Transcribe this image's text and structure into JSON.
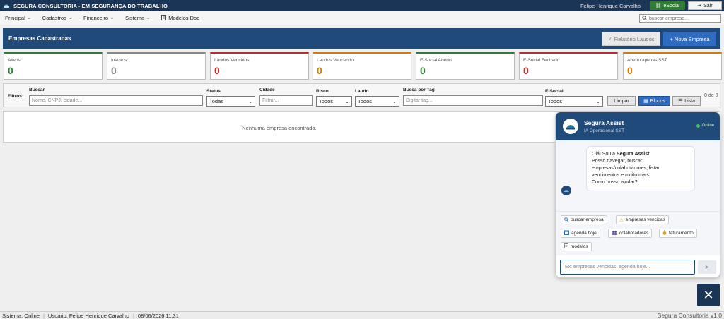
{
  "titlebar": {
    "title": "SEGURA CONSULTORIA - EM SEGURANÇA DO TRABALHO",
    "user": "Felipe Henrique Carvalho",
    "esocial_label": "eSocial",
    "sair_label": "Sair"
  },
  "menu": {
    "items": [
      {
        "label": "Principal",
        "has_dropdown": true
      },
      {
        "label": "Cadastros",
        "has_dropdown": true
      },
      {
        "label": "Financeiro",
        "has_dropdown": true
      },
      {
        "label": "Sistema",
        "has_dropdown": true
      },
      {
        "label": "Modelos Doc",
        "has_dropdown": false
      }
    ],
    "search_placeholder": "buscar empresa..."
  },
  "panel": {
    "title": "Empresas Cadastradas",
    "relatorio_label": "Relatório Laudos",
    "nova_label": "+ Nova Empresa"
  },
  "cards": [
    {
      "label": "Ativos",
      "value": "0",
      "color": "#2e7d32"
    },
    {
      "label": "Inativos",
      "value": "0",
      "color": "#888888"
    },
    {
      "label": "Laudos Vencidos",
      "value": "0",
      "color": "#c62828"
    },
    {
      "label": "Laudos Vencendo",
      "value": "0",
      "color": "#d97a00"
    },
    {
      "label": "E-Social Aberto",
      "value": "0",
      "color": "#2e7d32"
    },
    {
      "label": "E-Social Fechado",
      "value": "0",
      "color": "#c62828"
    },
    {
      "label": "Aberto apenas SST",
      "value": "0",
      "color": "#d97a00"
    }
  ],
  "filters": {
    "title": "Filtros:",
    "buscar_label": "Buscar",
    "buscar_placeholder": "Nome, CNPJ, cidade...",
    "status_label": "Status",
    "status_value": "Todas",
    "cidade_label": "Cidade",
    "cidade_placeholder": "Filtrar...",
    "risco_label": "Risco",
    "risco_value": "Todos",
    "laudo_label": "Laudo",
    "laudo_value": "Todos",
    "tag_label": "Busca por Tag",
    "tag_placeholder": "Digitar tag...",
    "esocial_label": "E-Social",
    "esocial_value": "Todos",
    "limpar_label": "Limpar",
    "blocos_label": "Blocos",
    "lista_label": "Lista",
    "count": "0 de 0"
  },
  "empty_message": "Nenhuma empresa encontrada.",
  "chat": {
    "name": "Segura Assist",
    "subtitle": "IA Operacional SST",
    "status": "Online",
    "greeting_prefix": "Olá! Sou a ",
    "greeting_name": "Segura Assist",
    "greeting_suffix": ".",
    "greeting_lines": [
      "Posso navegar, buscar",
      "empresas/colaboradores, listar",
      "vencimentos e muito mais.",
      "Como posso ajudar?"
    ],
    "chips": [
      {
        "label": "buscar empresa",
        "icon": "search-icon"
      },
      {
        "label": "empresas vencidas",
        "icon": "warning-icon"
      },
      {
        "label": "agenda hoje",
        "icon": "calendar-icon"
      },
      {
        "label": "colaboradores",
        "icon": "people-icon"
      },
      {
        "label": "faturamento",
        "icon": "money-bag-icon"
      },
      {
        "label": "modelos",
        "icon": "document-icon"
      }
    ],
    "input_placeholder": "Ex: empresas vencidas, agenda hoje..."
  },
  "statusbar": {
    "sistema": "Sistema: Online",
    "usuario": "Usuario: Felipe Henrique Carvalho",
    "datetime": "08/06/2026 11:31",
    "version": "Segura Consultoria v1.0"
  }
}
